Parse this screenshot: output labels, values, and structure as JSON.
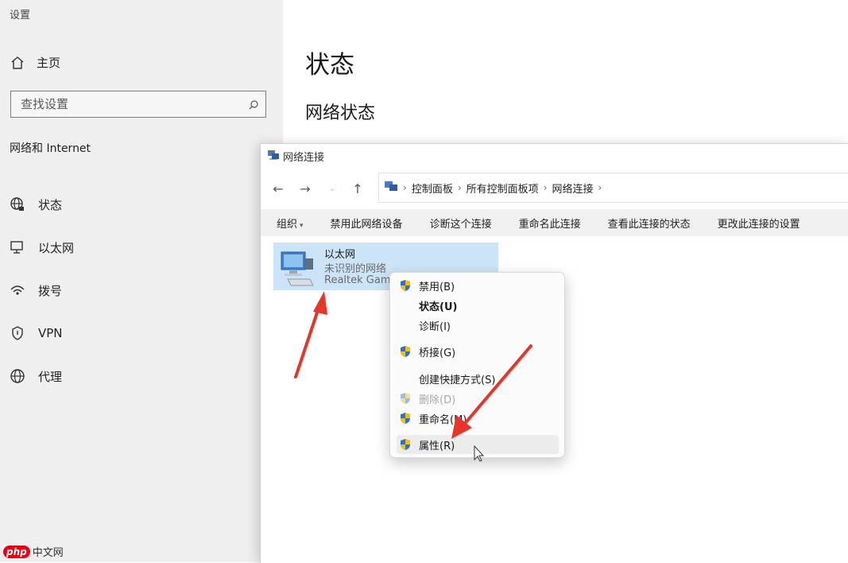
{
  "settings": {
    "app_title": "设置",
    "home_label": "主页",
    "search_placeholder": "查找设置",
    "section_heading": "网络和 Internet",
    "nav_items": [
      {
        "label": "状态",
        "icon": "globe-status-icon"
      },
      {
        "label": "以太网",
        "icon": "ethernet-icon"
      },
      {
        "label": "拨号",
        "icon": "dialup-icon"
      },
      {
        "label": "VPN",
        "icon": "vpn-shield-icon"
      },
      {
        "label": "代理",
        "icon": "proxy-globe-icon"
      }
    ],
    "page_title": "状态",
    "sub_title": "网络状态"
  },
  "explorer": {
    "title": "网络连接",
    "breadcrumb": [
      "控制面板",
      "所有控制面板项",
      "网络连接"
    ],
    "commands": {
      "organize": "组织",
      "disable": "禁用此网络设备",
      "diagnose": "诊断这个连接",
      "rename": "重命名此连接",
      "view_status": "查看此连接的状态",
      "change_settings": "更改此连接的设置"
    },
    "adapter": {
      "name": "以太网",
      "status": "未识别的网络",
      "device": "Realtek Gam"
    }
  },
  "context_menu": {
    "items": [
      {
        "label": "禁用(B)",
        "shield": true,
        "bold": false,
        "disabled": false
      },
      {
        "label": "状态(U)",
        "shield": false,
        "bold": true,
        "disabled": false
      },
      {
        "label": "诊断(I)",
        "shield": false,
        "bold": false,
        "disabled": false
      },
      {
        "label": "桥接(G)",
        "shield": true,
        "bold": false,
        "disabled": false
      },
      {
        "label": "创建快捷方式(S)",
        "shield": false,
        "bold": false,
        "disabled": false
      },
      {
        "label": "删除(D)",
        "shield": true,
        "bold": false,
        "disabled": true
      },
      {
        "label": "重命名(M)",
        "shield": true,
        "bold": false,
        "disabled": false
      },
      {
        "label": "属性(R)",
        "shield": true,
        "bold": false,
        "disabled": false,
        "hovered": true
      }
    ]
  },
  "watermark": {
    "logo": "php",
    "text": "中文网"
  },
  "colors": {
    "sidebar_bg": "#efefef",
    "selection": "#cce4f7",
    "annotation_arrow": "#e8352a"
  }
}
